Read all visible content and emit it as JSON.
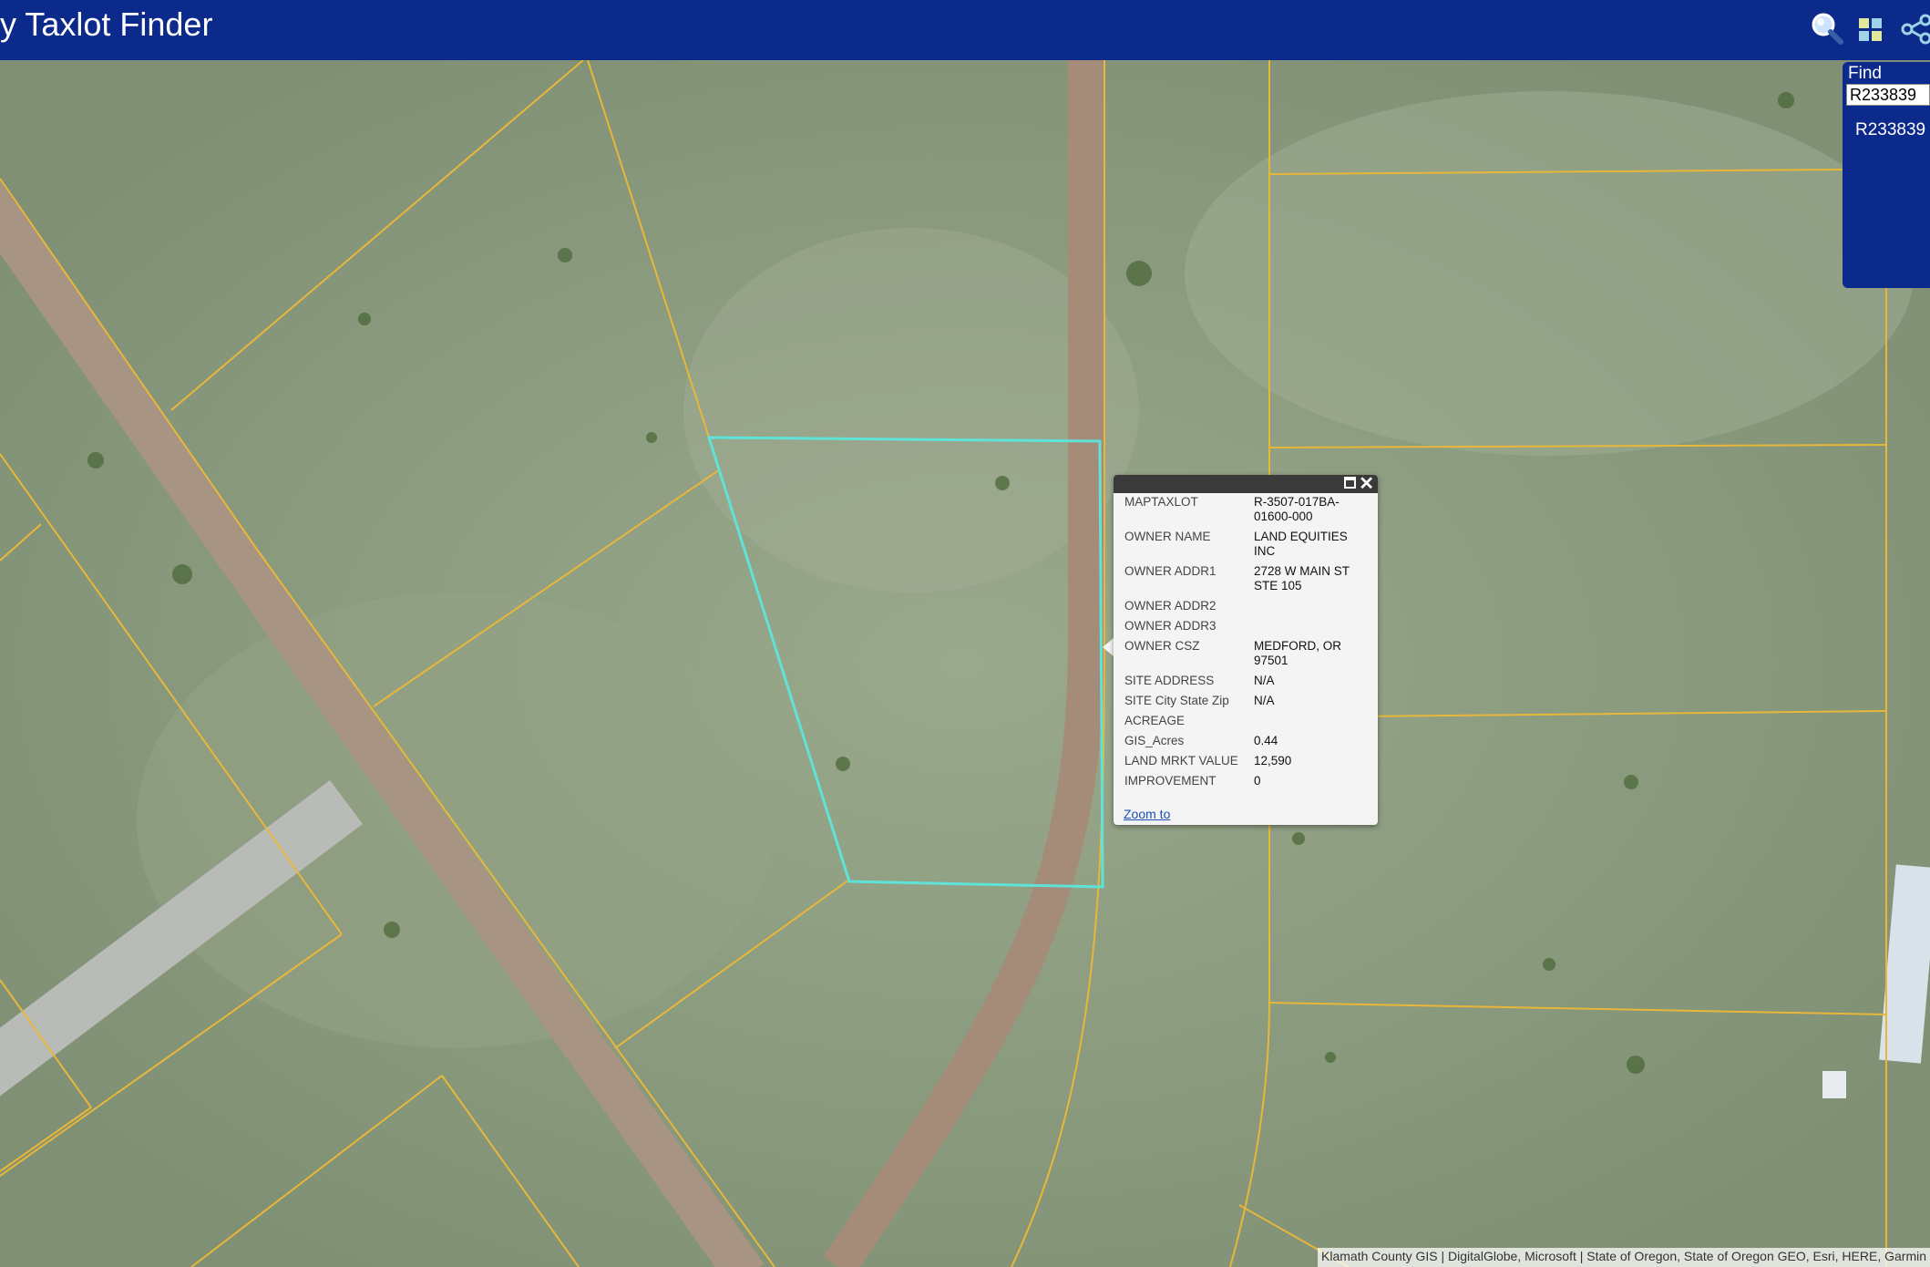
{
  "header": {
    "title": "y Taxlot Finder",
    "icons": [
      "search-icon",
      "grid-icon",
      "share-icon"
    ],
    "background": "#0c2a8c"
  },
  "find": {
    "label": "Find",
    "input_value": "R233839",
    "result": "R233839"
  },
  "popup": {
    "rows": [
      {
        "key": "MAPTAXLOT",
        "value": "R-3507-017BA-01600-000"
      },
      {
        "key": "OWNER NAME",
        "value": "LAND EQUITIES INC"
      },
      {
        "key": "OWNER ADDR1",
        "value": "2728 W MAIN ST STE 105"
      },
      {
        "key": "OWNER ADDR2",
        "value": ""
      },
      {
        "key": "OWNER ADDR3",
        "value": ""
      },
      {
        "key": "OWNER CSZ",
        "value": "MEDFORD, OR 97501"
      },
      {
        "key": "SITE ADDRESS",
        "value": "N/A"
      },
      {
        "key": "SITE City State Zip",
        "value": "N/A"
      },
      {
        "key": "ACREAGE",
        "value": ""
      },
      {
        "key": "GIS_Acres",
        "value": "0.44"
      },
      {
        "key": "LAND MRKT VALUE",
        "value": "12,590"
      },
      {
        "key": "IMPROVEMENT",
        "value": "0"
      }
    ],
    "zoom_link": "Zoom to",
    "close_symbol": "✕"
  },
  "map": {
    "parcel_line_color": "#e8b73a",
    "selected_parcel_color": "#5fe3d8",
    "imagery_color": "#8a9a7e",
    "road_color": "#a48c78"
  },
  "attribution": "Klamath County GIS | DigitalGlobe, Microsoft | State of Oregon, State of Oregon GEO, Esri, HERE, Garmin"
}
